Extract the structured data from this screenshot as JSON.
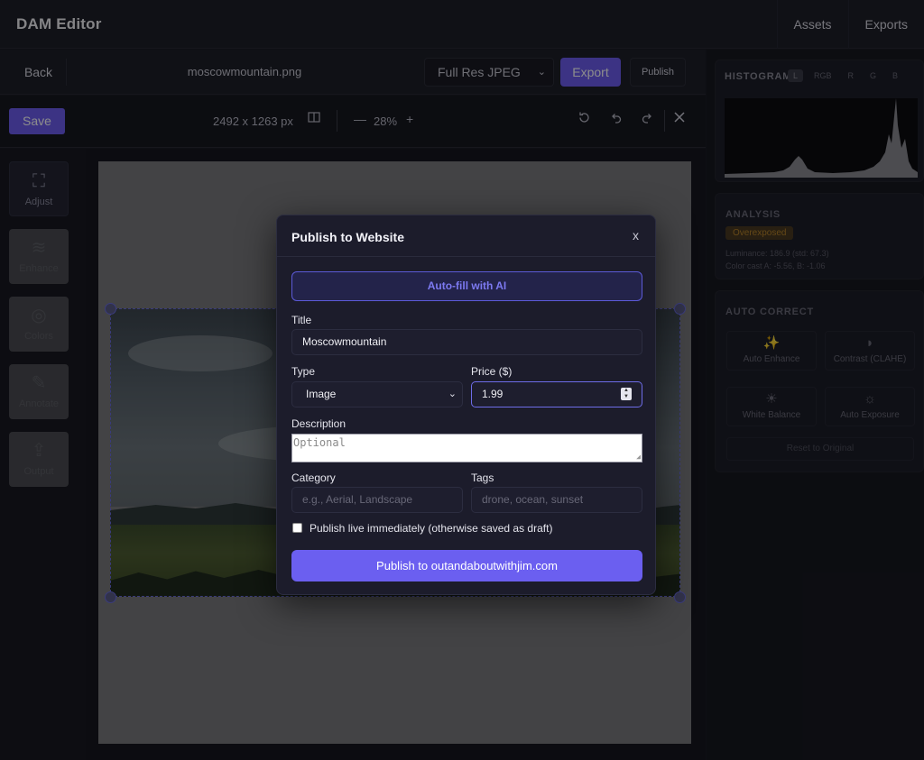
{
  "app": {
    "title": "DAM Editor",
    "nav": [
      "Assets",
      "Exports"
    ]
  },
  "editor": {
    "back_label": "Back",
    "filename": "moscowmountain.png",
    "format_selected": "Full Res JPEG",
    "export_label": "Export",
    "publish_label": "Publish",
    "save_label": "Save",
    "dimensions": "2492 x 1263 px",
    "zoom": "28%",
    "zoom_out": "—",
    "zoom_in": "+"
  },
  "tools": [
    {
      "icon": "⛶",
      "label": "Adjust",
      "icon_name": "crop-frame-icon"
    },
    {
      "icon": "≋",
      "label": "Enhance",
      "icon_name": "sliders-icon"
    },
    {
      "icon": "◎",
      "label": "Colors",
      "icon_name": "color-circles-icon"
    },
    {
      "icon": "✎",
      "label": "Annotate",
      "icon_name": "pencil-icon"
    },
    {
      "icon": "⇪",
      "label": "Output",
      "icon_name": "export-icon"
    }
  ],
  "histogram": {
    "title": "HISTOGRAM",
    "channels": [
      "L",
      "RGB",
      "R",
      "G",
      "B"
    ],
    "active": "L"
  },
  "analysis": {
    "title": "ANALYSIS",
    "badge": "Overexposed",
    "luminance": "Luminance: 186.9 (std: 67.3)",
    "colorcast": "Color cast A: -5.56, B: -1.06"
  },
  "autocorrect": {
    "title": "AUTO CORRECT",
    "buttons": [
      {
        "icon": "✨",
        "label": "Auto Enhance"
      },
      {
        "icon": "◗",
        "label": "Contrast (CLAHE)"
      },
      {
        "icon": "☀",
        "label": "White Balance"
      },
      {
        "icon": "☼",
        "label": "Auto Exposure"
      }
    ],
    "reset_label": "Reset to Original"
  },
  "modal": {
    "title": "Publish to Website",
    "close": "x",
    "autofill_label": "Auto-fill with AI",
    "title_label": "Title",
    "title_value": "Moscowmountain",
    "type_label": "Type",
    "type_value": "Image",
    "price_label": "Price ($)",
    "price_value": "1.99",
    "description_label": "Description",
    "description_placeholder": "Optional",
    "category_label": "Category",
    "category_placeholder": "e.g., Aerial, Landscape",
    "tags_label": "Tags",
    "tags_placeholder": "drone, ocean, sunset",
    "publish_live_label": "Publish live immediately (otherwise saved as draft)",
    "submit_label": "Publish to outandaboutwithjim.com"
  },
  "colors": {
    "accent": "#6d5ef0",
    "panel": "#1c1c2b",
    "warning": "#b8842a"
  }
}
